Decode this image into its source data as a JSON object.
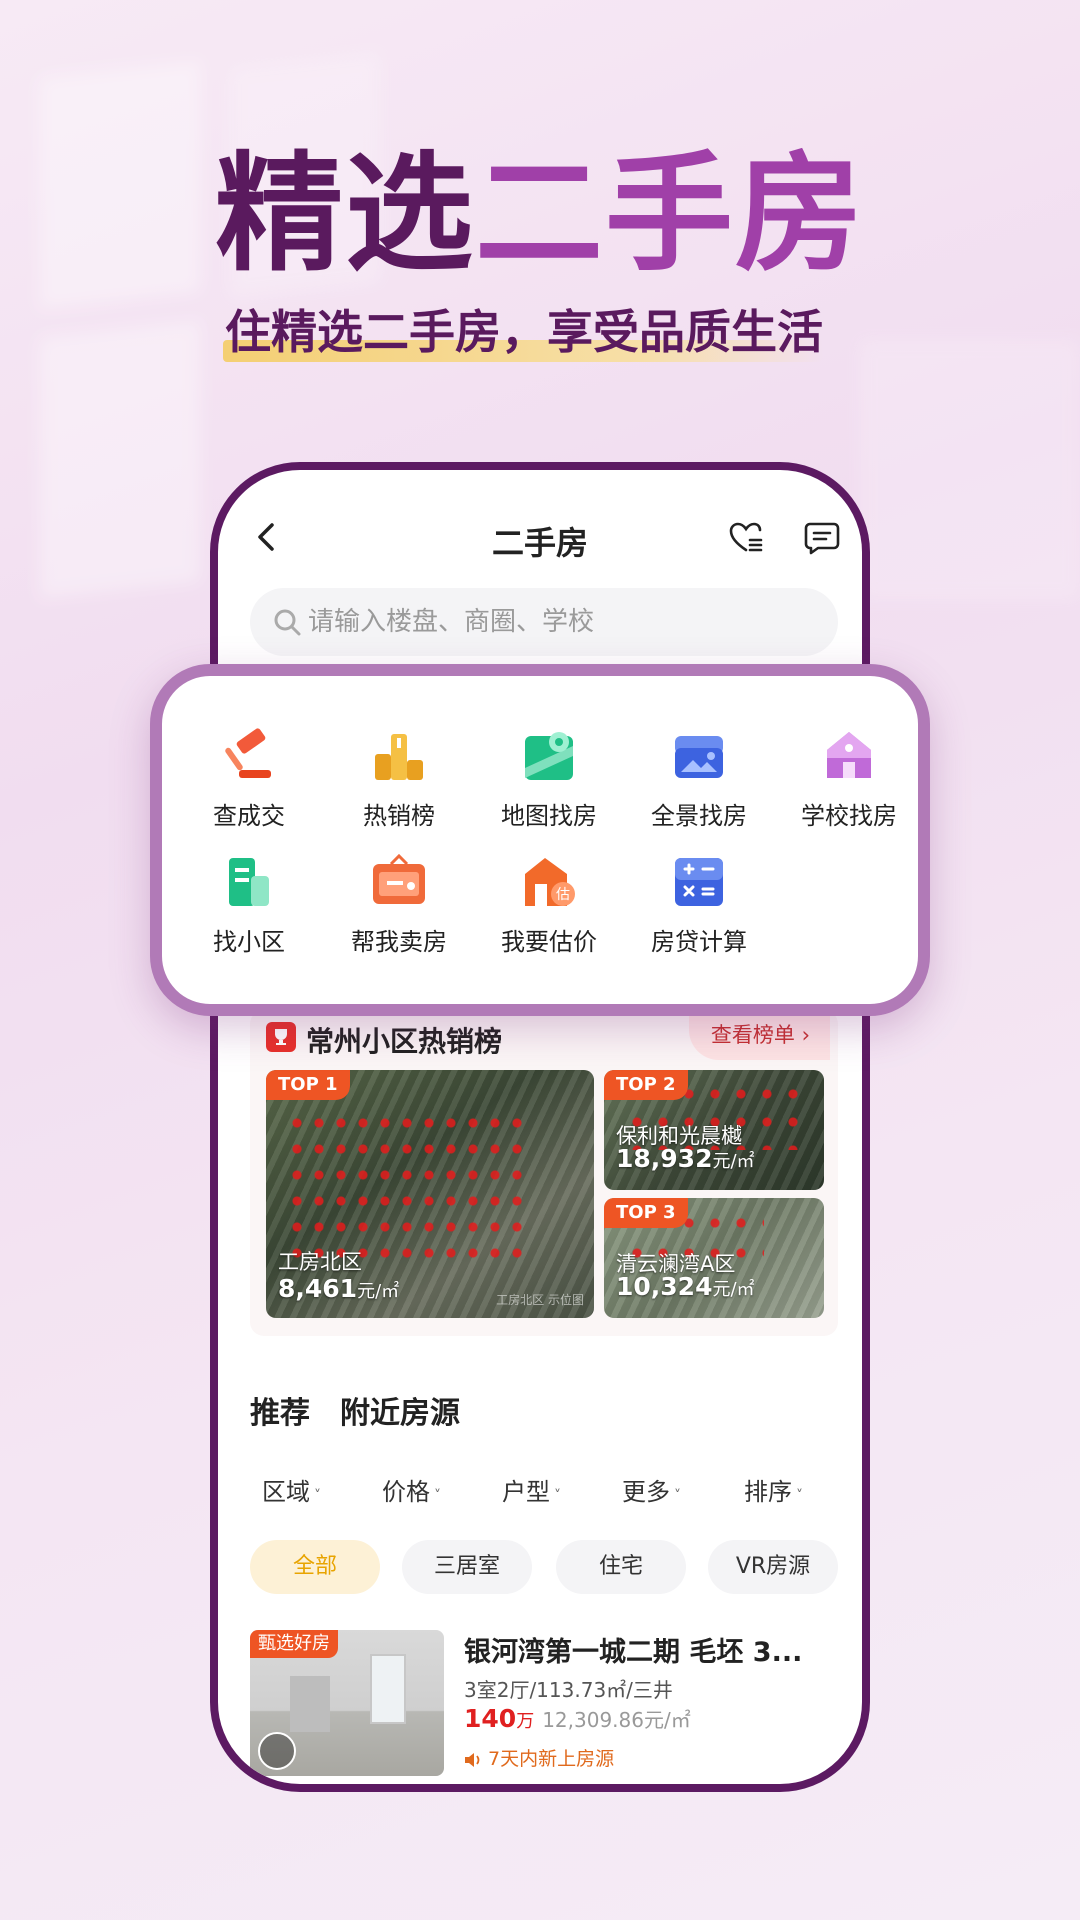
{
  "hero": {
    "title_a": "精选",
    "title_b": "二手房",
    "subtitle": "住精选二手房，享受品质生活"
  },
  "header": {
    "title": "二手房"
  },
  "search": {
    "placeholder": "请输入楼盘、商圈、学校"
  },
  "grid": {
    "items": [
      {
        "label": "查成交",
        "icon": "gavel-icon"
      },
      {
        "label": "热销榜",
        "icon": "podium-icon"
      },
      {
        "label": "地图找房",
        "icon": "map-pin-icon"
      },
      {
        "label": "全景找房",
        "icon": "panorama-icon"
      },
      {
        "label": "学校找房",
        "icon": "school-icon"
      },
      {
        "label": "找小区",
        "icon": "building-icon"
      },
      {
        "label": "帮我卖房",
        "icon": "sell-sign-icon"
      },
      {
        "label": "我要估价",
        "icon": "valuation-house-icon"
      },
      {
        "label": "房贷计算",
        "icon": "calculator-icon"
      }
    ]
  },
  "ranking": {
    "title": "常州小区热销榜",
    "more": "查看榜单 ›",
    "cards": [
      {
        "badge": "TOP 1",
        "name": "工房北区",
        "price": "8,461",
        "unit": "元/㎡",
        "watermark": "工房北区 示位图"
      },
      {
        "badge": "TOP 2",
        "name": "保利和光晨樾",
        "price": "18,932",
        "unit": "元/㎡"
      },
      {
        "badge": "TOP 3",
        "name": "清云澜湾A区",
        "price": "10,324",
        "unit": "元/㎡"
      }
    ]
  },
  "tabs": [
    {
      "label": "推荐"
    },
    {
      "label": "附近房源"
    }
  ],
  "filters": [
    {
      "label": "区域"
    },
    {
      "label": "价格"
    },
    {
      "label": "户型"
    },
    {
      "label": "更多"
    },
    {
      "label": "排序"
    }
  ],
  "chips": [
    {
      "label": "全部"
    },
    {
      "label": "三居室"
    },
    {
      "label": "住宅"
    },
    {
      "label": "VR房源"
    }
  ],
  "listing": {
    "badge": "甄选好房",
    "title": "银河湾第一城二期 毛坯 3...",
    "spec": "3室2厅/113.73㎡/三井",
    "price": "140",
    "price_unit": "万",
    "unit_price": "12,309.86元/㎡",
    "tag": "7天内新上房源"
  },
  "colors": {
    "brand_purple": "#5c1a62",
    "accent_purple": "#a040a8",
    "badge_orange": "#ee5524",
    "price_red": "#e02020",
    "chip_active": "#e8a400"
  }
}
